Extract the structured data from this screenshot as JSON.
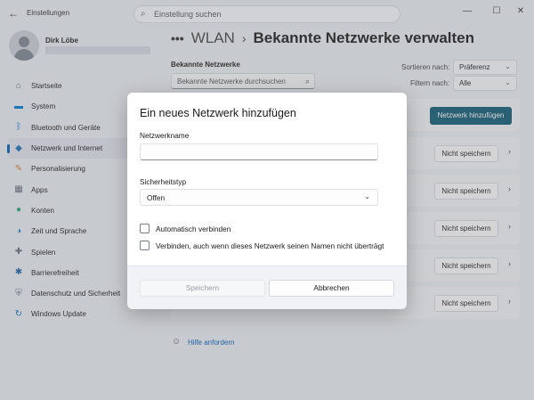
{
  "window": {
    "app_title": "Einstellungen",
    "back_glyph": "←",
    "search_placeholder": "Einstellung suchen",
    "minimize_glyph": "—",
    "maximize_glyph": "☐",
    "close_glyph": "✕"
  },
  "profile": {
    "name": "Dirk Löbe"
  },
  "sidebar": {
    "items": [
      {
        "label": "Startseite",
        "icon": "home-icon",
        "glyph": "⌂",
        "color": "#5f6b7a"
      },
      {
        "label": "System",
        "icon": "monitor-icon",
        "glyph": "▬",
        "color": "#0078d4"
      },
      {
        "label": "Bluetooth und Geräte",
        "icon": "bluetooth-icon",
        "glyph": "ᛒ",
        "color": "#0078d4"
      },
      {
        "label": "Netzwerk und Internet",
        "icon": "wifi-icon",
        "glyph": "◆",
        "color": "#1a6fb5",
        "active": true
      },
      {
        "label": "Personalisierung",
        "icon": "brush-icon",
        "glyph": "✎",
        "color": "#d97a2b"
      },
      {
        "label": "Apps",
        "icon": "apps-icon",
        "glyph": "▦",
        "color": "#5f6b7a"
      },
      {
        "label": "Konten",
        "icon": "account-icon",
        "glyph": "●",
        "color": "#2aa36b"
      },
      {
        "label": "Zeit und Sprache",
        "icon": "globe-clock-icon",
        "glyph": "◑",
        "color": "#1a7fc1"
      },
      {
        "label": "Spielen",
        "icon": "gamepad-icon",
        "glyph": "✚",
        "color": "#5f6b7a"
      },
      {
        "label": "Barrierefreiheit",
        "icon": "accessibility-icon",
        "glyph": "✱",
        "color": "#1f5fa8"
      },
      {
        "label": "Datenschutz und Sicherheit",
        "icon": "shield-icon",
        "glyph": "⛨",
        "color": "#6b7683"
      },
      {
        "label": "Windows Update",
        "icon": "update-icon",
        "glyph": "↻",
        "color": "#1a6fb5"
      }
    ]
  },
  "breadcrumb": {
    "dots": "•••",
    "parent": "WLAN",
    "separator": "›",
    "current": "Bekannte Netzwerke verwalten"
  },
  "known_networks": {
    "label": "Bekannte Netzwerke",
    "search_placeholder": "Bekannte Netzwerke durchsuchen",
    "sort_label": "Sortieren nach:",
    "sort_value": "Präferenz",
    "filter_label": "Filtern nach:",
    "filter_value": "Alle",
    "add_button": "Netzwerk hinzufügen",
    "forget_button": "Nicht speichern",
    "row_chevron": "›",
    "row_count": 5
  },
  "help": {
    "label": "Hilfe anfordern"
  },
  "dialog": {
    "title": "Ein neues Netzwerk hinzufügen",
    "network_name_label": "Netzwerkname",
    "network_name_value": "",
    "security_label": "Sicherheitstyp",
    "security_value": "Offen",
    "auto_connect_label": "Automatisch verbinden",
    "auto_connect_checked": false,
    "hidden_connect_label": "Verbinden, auch wenn dieses Netzwerk seinen Namen nicht überträgt",
    "hidden_connect_checked": false,
    "save_button": "Speichern",
    "cancel_button": "Abbrechen"
  },
  "colors": {
    "accent": "#0f5b74",
    "link": "#005fb8",
    "background": "#e9edf3",
    "dialog": "#ffffff"
  }
}
